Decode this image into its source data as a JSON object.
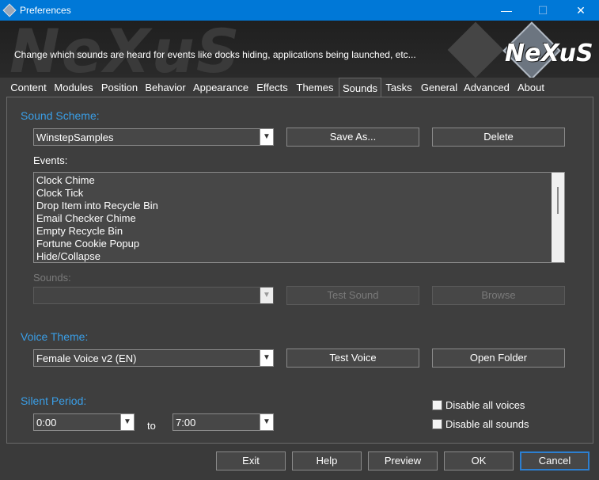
{
  "window": {
    "title": "Preferences",
    "min_glyph": "—",
    "max_glyph": "☐",
    "close_glyph": "✕"
  },
  "banner": {
    "description": "Change which sounds are heard for events like docks hiding, applications being launched, etc...",
    "logo_text": "NeXuS",
    "watermark_text": "NeXuS"
  },
  "tabs": [
    "Content",
    "Modules",
    "Position",
    "Behavior",
    "Appearance",
    "Effects",
    "Themes",
    "Sounds",
    "Tasks",
    "General",
    "Advanced",
    "About"
  ],
  "active_tab": "Sounds",
  "sound_scheme": {
    "heading": "Sound Scheme:",
    "selected": "WinstepSamples",
    "save_as_label": "Save As...",
    "delete_label": "Delete"
  },
  "events": {
    "label": "Events:",
    "items": [
      "Clock Chime",
      "Clock Tick",
      "Drop Item into Recycle Bin",
      "Email Checker Chime",
      "Empty Recycle Bin",
      "Fortune Cookie Popup",
      "Hide/Collapse"
    ]
  },
  "sounds": {
    "label": "Sounds:",
    "selected": "",
    "test_sound_label": "Test Sound",
    "browse_label": "Browse"
  },
  "voice_theme": {
    "heading": "Voice Theme:",
    "selected": "Female Voice v2 (EN)",
    "test_voice_label": "Test Voice",
    "open_folder_label": "Open Folder"
  },
  "silent_period": {
    "heading": "Silent Period:",
    "from": "0:00",
    "to_label": "to",
    "to": "7:00"
  },
  "options": {
    "disable_voices_label": "Disable all voices",
    "disable_voices_checked": false,
    "disable_sounds_label": "Disable all sounds",
    "disable_sounds_checked": false
  },
  "footer": {
    "exit_label": "Exit",
    "help_label": "Help",
    "preview_label": "Preview",
    "ok_label": "OK",
    "cancel_label": "Cancel"
  },
  "colors": {
    "titlebar": "#0078d7",
    "accent_heading": "#3a9ee6",
    "background": "#3a3a3a"
  },
  "icons": {
    "combo_arrow": "chevron-down-icon",
    "app": "nexus-app-icon"
  }
}
